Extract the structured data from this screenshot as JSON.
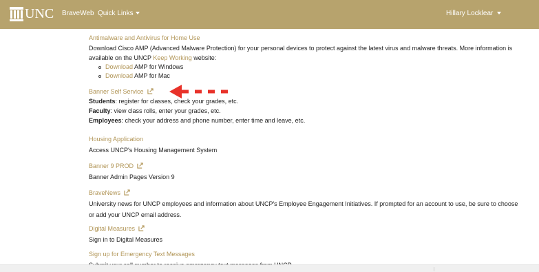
{
  "header": {
    "logo_text": "UNC",
    "nav": [
      {
        "label": "BraveWeb"
      },
      {
        "label": "Quick Links"
      }
    ],
    "user_menu": "Hillary Locklear"
  },
  "sections": {
    "antimalware": {
      "title": "Antimalware and Antivirus for Home Use",
      "desc_1": "Download Cisco AMP (Advanced Malware Protection) for your personal devices to protect against the latest virus and malware threats. More information is",
      "desc_2_pre": "available on the UNCP ",
      "desc_2_link": "Keep Working",
      "desc_2_post": " website:",
      "downloads": [
        {
          "link": "Download",
          "text": " AMP for Windows"
        },
        {
          "link": "Download",
          "text": " AMP for Mac"
        }
      ]
    },
    "banner_ss": {
      "title": "Banner Self Service",
      "lines": [
        {
          "bold": "Students",
          "text": ": register for classes, check your grades, etc."
        },
        {
          "bold": "Faculty",
          "text": ": view class rolls, enter your grades, etc."
        },
        {
          "bold": "Employees",
          "text": ": check your address and phone number, enter time and leave, etc."
        }
      ]
    },
    "housing": {
      "title": "Housing Application",
      "desc": "Access UNCP's Housing Management System"
    },
    "banner9": {
      "title": "Banner 9 PROD",
      "desc": "Banner Admin Pages Version 9"
    },
    "bravenews": {
      "title": "BraveNews",
      "desc_1": "University news for UNCP employees and information about UNCP's Employee Engagement Initiatives. If prompted for an account to use, be sure to choose",
      "desc_2": "or add your UNCP email address."
    },
    "digital": {
      "title": "Digital Measures",
      "desc": "Sign in to Digital Measures"
    },
    "emergency": {
      "title": "Sign up for Emergency Text Messages",
      "desc": "Submit your cell number to receive emergency text messages from UNCP."
    }
  },
  "colors": {
    "navbar": "#b7a36d",
    "link": "#b19556",
    "arrow": "#e8322a"
  }
}
